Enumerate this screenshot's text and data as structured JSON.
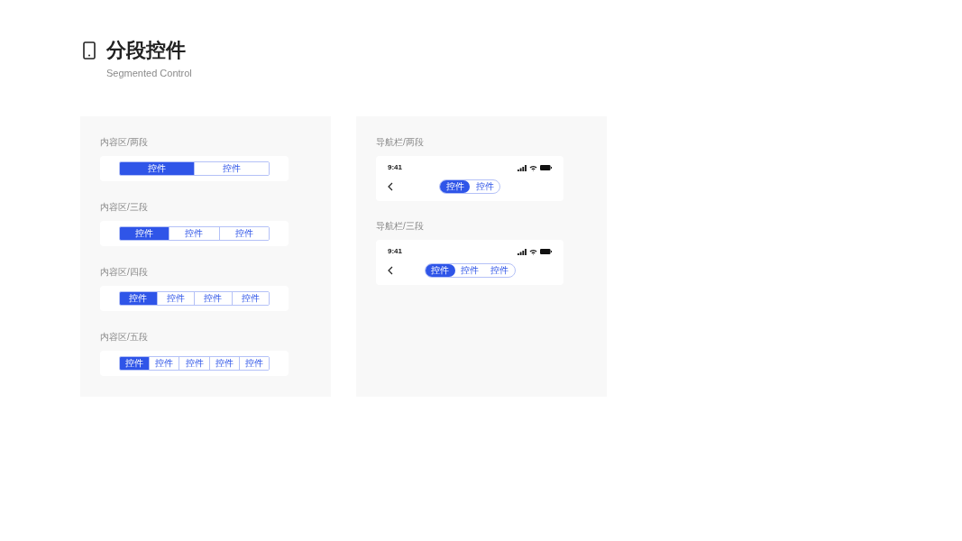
{
  "header": {
    "title": "分段控件",
    "subtitle": "Segmented Control"
  },
  "content_sections": [
    {
      "label": "内容区/两段",
      "segments": [
        {
          "label": "控件",
          "selected": true
        },
        {
          "label": "控件",
          "selected": false
        }
      ]
    },
    {
      "label": "内容区/三段",
      "segments": [
        {
          "label": "控件",
          "selected": true
        },
        {
          "label": "控件",
          "selected": false
        },
        {
          "label": "控件",
          "selected": false
        }
      ]
    },
    {
      "label": "内容区/四段",
      "segments": [
        {
          "label": "控件",
          "selected": true
        },
        {
          "label": "控件",
          "selected": false
        },
        {
          "label": "控件",
          "selected": false
        },
        {
          "label": "控件",
          "selected": false
        }
      ]
    },
    {
      "label": "内容区/五段",
      "segments": [
        {
          "label": "控件",
          "selected": true
        },
        {
          "label": "控件",
          "selected": false
        },
        {
          "label": "控件",
          "selected": false
        },
        {
          "label": "控件",
          "selected": false
        },
        {
          "label": "控件",
          "selected": false
        }
      ]
    }
  ],
  "nav_sections": [
    {
      "label": "导航栏/两段",
      "time": "9:41",
      "segments": [
        {
          "label": "控件",
          "selected": true
        },
        {
          "label": "控件",
          "selected": false
        }
      ]
    },
    {
      "label": "导航栏/三段",
      "time": "9:41",
      "segments": [
        {
          "label": "控件",
          "selected": true
        },
        {
          "label": "控件",
          "selected": false
        },
        {
          "label": "控件",
          "selected": false
        }
      ]
    }
  ]
}
